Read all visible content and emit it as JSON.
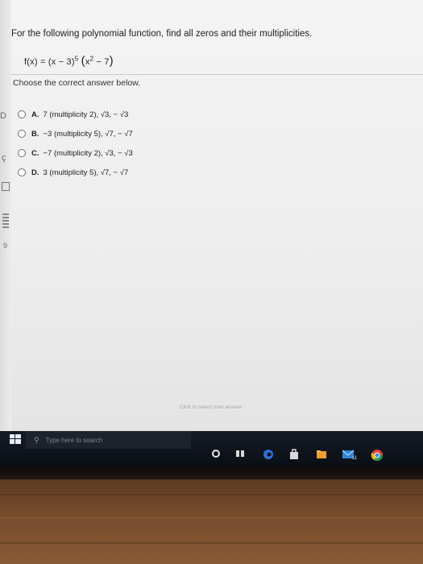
{
  "question": {
    "prompt": "For the following polynomial function, find all zeros and their multiplicities.",
    "formula": {
      "lhs": "f(x) = ",
      "factor1": "(x − 3)",
      "factor1_exp": "5",
      "factor2_open": "(",
      "factor2_base": "x",
      "factor2_exp": "2",
      "factor2_rest": " − 7",
      "factor2_close": ")"
    }
  },
  "instruction": "Choose the correct answer below.",
  "options": [
    {
      "letter": "A.",
      "text": "7 (multiplicity 2), √3, − √3"
    },
    {
      "letter": "B.",
      "text": "−3 (multiplicity 5), √7, − √7"
    },
    {
      "letter": "C.",
      "text": "−7 (multiplicity 2), √3, − √3"
    },
    {
      "letter": "D.",
      "text": "3 (multiplicity 5), √7, − √7"
    }
  ],
  "hint": "Click to select your answer.",
  "taskbar": {
    "search_placeholder": "Type here to search",
    "mail_badge": "11"
  },
  "edge_marks": {
    "a": "D",
    "b": "ç",
    "c": "9"
  },
  "colors": {
    "taskbar": "#0b0f16",
    "edge": "#2f6fd8",
    "store": "#f0a02a",
    "mail": "#2b88d8",
    "chrome_red": "#db4437",
    "chrome_yellow": "#f4b400",
    "chrome_green": "#0f9d58",
    "chrome_blue": "#4285f4"
  },
  "icons": [
    "search-icon",
    "windows-logo-icon",
    "cortana-icon",
    "task-view-icon",
    "edge-browser-icon",
    "store-icon",
    "file-explorer-icon",
    "mail-icon",
    "chrome-icon"
  ]
}
